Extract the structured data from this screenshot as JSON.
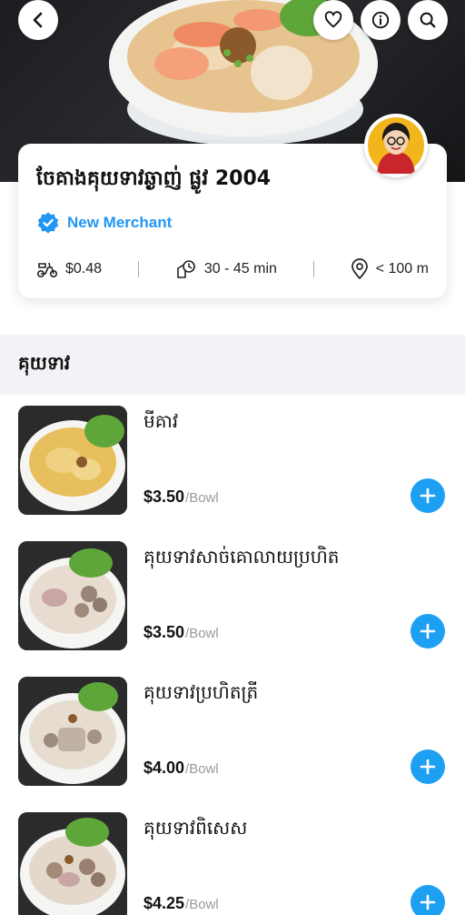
{
  "colors": {
    "accent": "#1ea0f2",
    "badge": "#2196f3"
  },
  "header": {
    "icons": [
      "back-arrow-icon",
      "heart-icon",
      "info-icon",
      "search-icon"
    ]
  },
  "merchant": {
    "name": "ចែគាងគុយទាវឆ្ងាញ់ ផ្លូវ 2004",
    "badge": "New Merchant",
    "delivery_fee": "$0.48",
    "delivery_time": "30 - 45 min",
    "distance": "< 100 m"
  },
  "section": {
    "title": "គុយទាវ"
  },
  "items": [
    {
      "name": "មីគាវ",
      "price": "$3.50",
      "unit": "/Bowl"
    },
    {
      "name": "គុយទាវសាច់គោលាយប្រហិត",
      "price": "$3.50",
      "unit": "/Bowl"
    },
    {
      "name": "គុយទាវប្រហិតត្រី",
      "price": "$4.00",
      "unit": "/Bowl"
    },
    {
      "name": "គុយទាវពិសេស",
      "price": "$4.25",
      "unit": "/Bowl"
    }
  ]
}
